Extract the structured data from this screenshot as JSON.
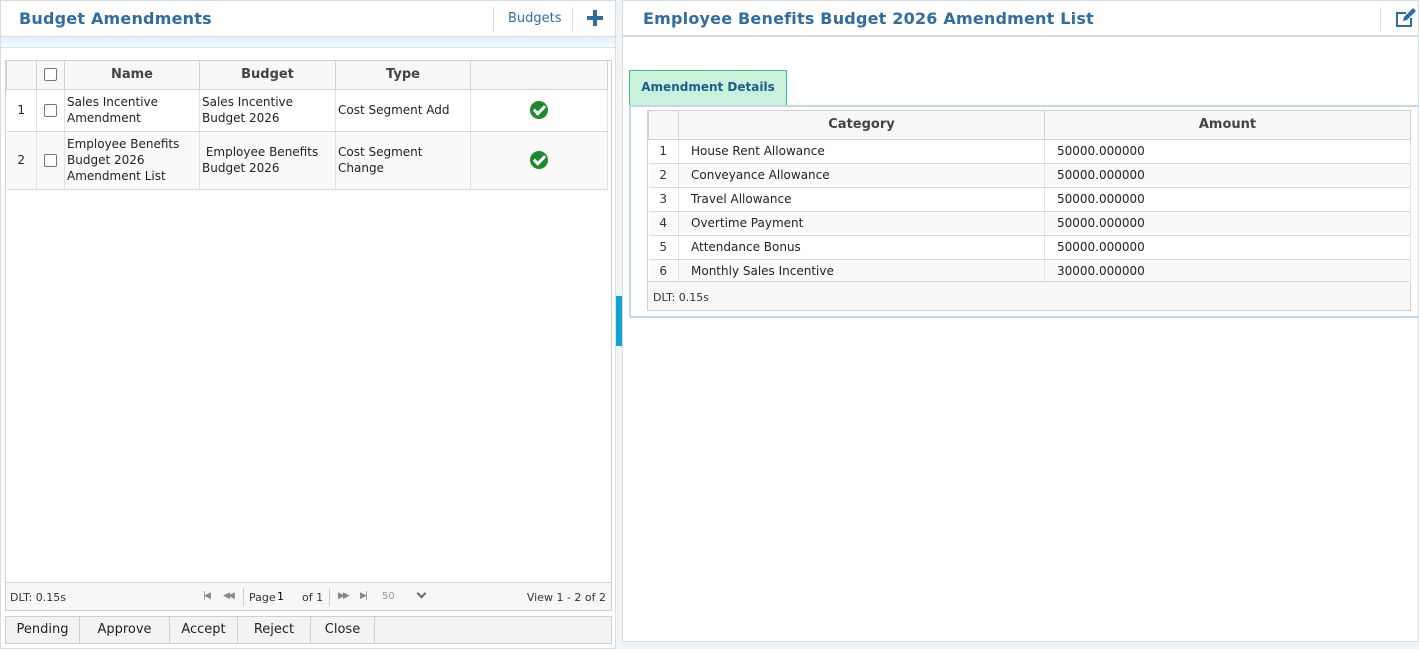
{
  "left": {
    "title": "Budget Amendments",
    "budgets_link": "Budgets",
    "columns": {
      "name": "Name",
      "budget": "Budget",
      "type": "Type"
    },
    "rows": [
      {
        "num": "1",
        "name": "Sales Incentive Amendment",
        "budget": "Sales Incentive Budget 2026",
        "type": "Cost Segment Add",
        "status_icon": "check-circle-icon"
      },
      {
        "num": "2",
        "name": "Employee Benefits Budget 2026 Amendment List",
        "budget": " Employee Benefits Budget 2026",
        "type": "Cost Segment Change",
        "status_icon": "check-circle-icon"
      }
    ],
    "footer": {
      "dlt": "DLT: 0.15s",
      "page_label": "Page",
      "page_value": "1",
      "of_label": "of 1",
      "rows_per_page": "50",
      "view": "View 1 - 2 of 2"
    },
    "actions": [
      "Pending",
      "Approve",
      "Accept",
      "Reject",
      "Close"
    ]
  },
  "right": {
    "title": "Employee Benefits Budget 2026 Amendment List",
    "tab": "Amendment Details",
    "columns": {
      "category": "Category",
      "amount": "Amount"
    },
    "rows": [
      {
        "num": "1",
        "category": "House Rent Allowance",
        "amount": "50000.000000"
      },
      {
        "num": "2",
        "category": "Conveyance Allowance",
        "amount": "50000.000000"
      },
      {
        "num": "3",
        "category": "Travel Allowance",
        "amount": "50000.000000"
      },
      {
        "num": "4",
        "category": "Overtime Payment",
        "amount": "50000.000000"
      },
      {
        "num": "5",
        "category": "Attendance Bonus",
        "amount": "50000.000000"
      },
      {
        "num": "6",
        "category": "Monthly Sales Incentive",
        "amount": "30000.000000"
      }
    ],
    "footer": {
      "dlt": "DLT: 0.15s"
    }
  },
  "colors": {
    "title_blue": "#2f6da3",
    "tab_green": "#c9f2dd",
    "check_green": "#1c8a2b",
    "splitter_cyan": "#0fa6d6"
  }
}
